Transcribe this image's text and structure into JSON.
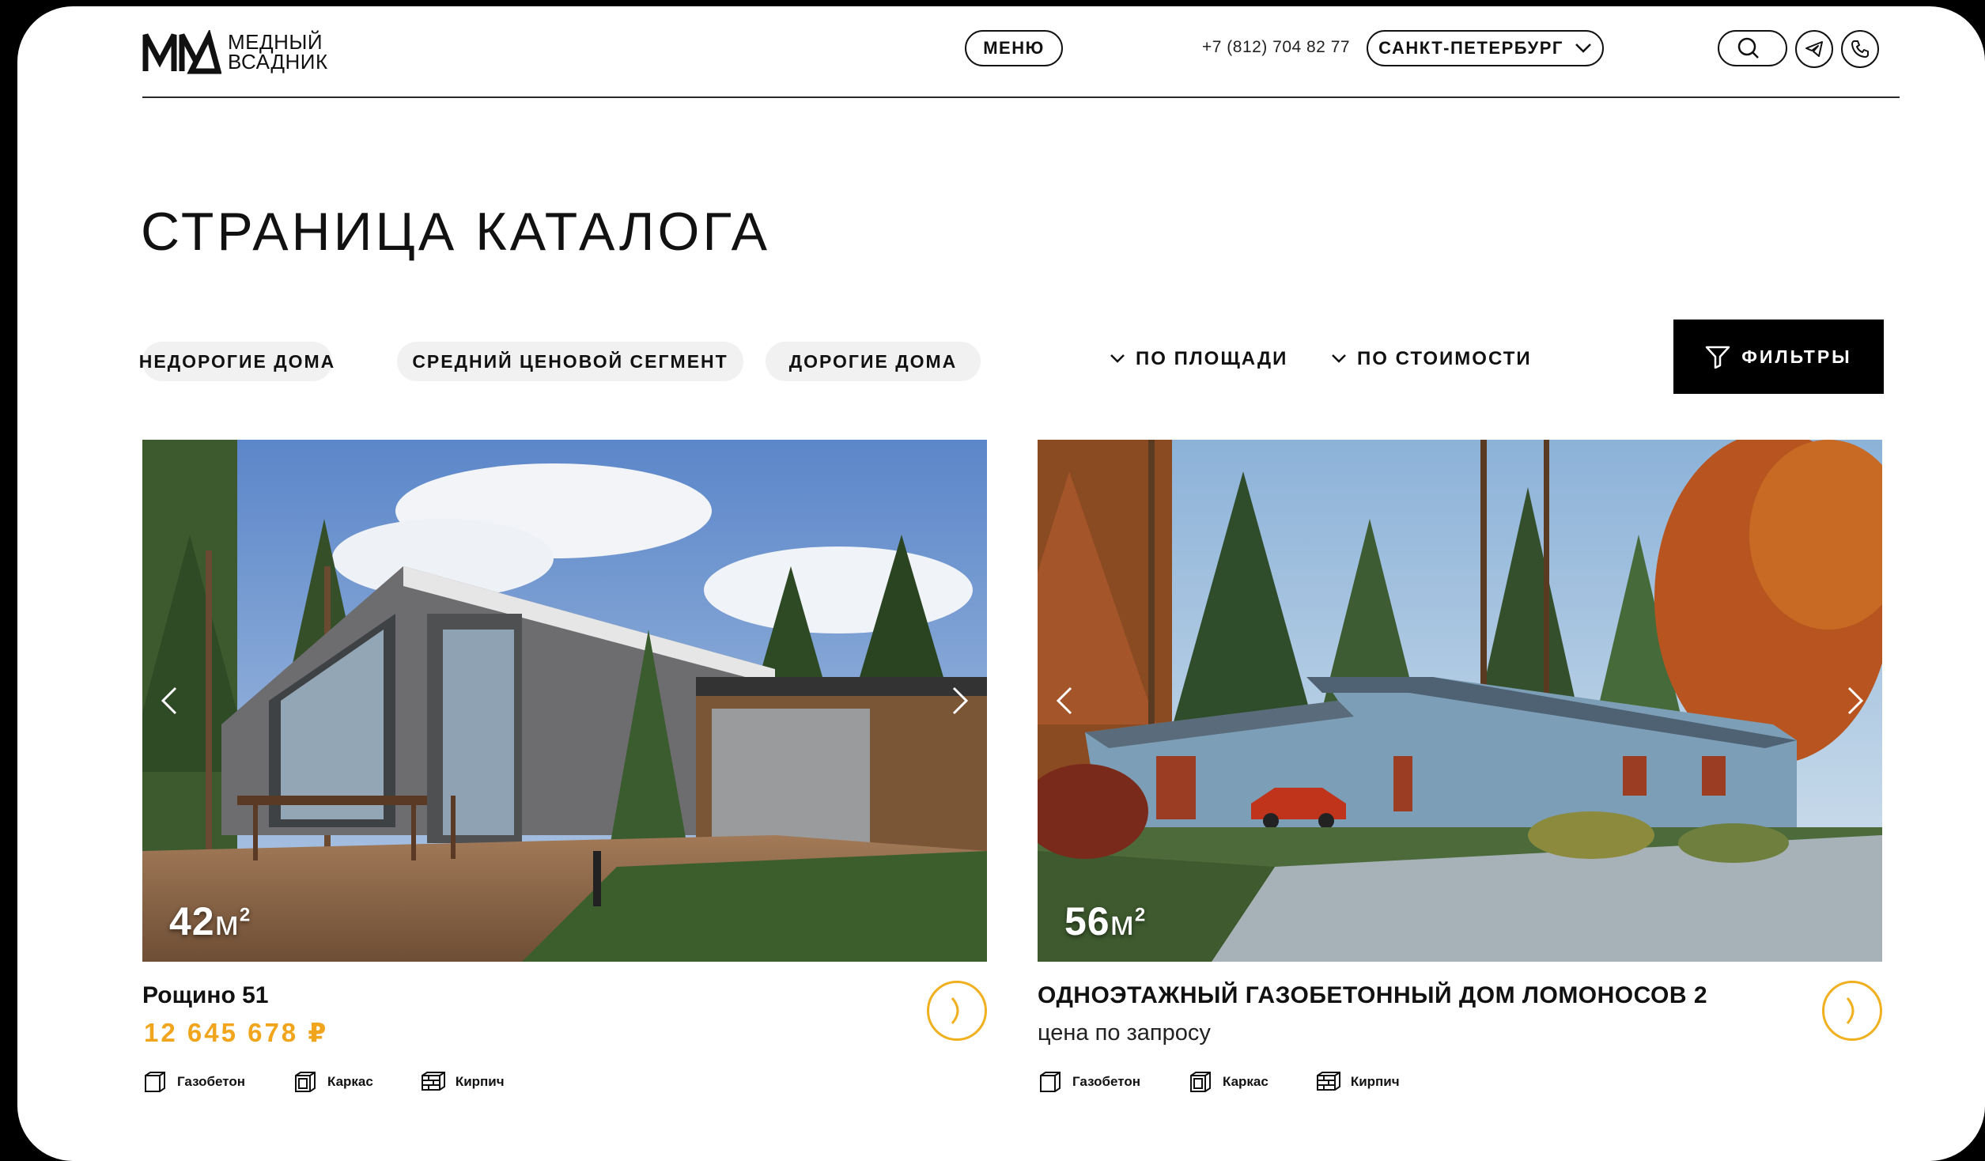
{
  "header": {
    "logo_line1": "МЕДНЫЙ",
    "logo_line2": "ВСАДНИК",
    "menu_label": "МЕНЮ",
    "phone": "+7 (812) 704 82 77",
    "city": "САНКТ-ПЕТЕРБУРГ"
  },
  "page": {
    "title": "СТРАНИЦА КАТАЛОГА"
  },
  "filters": {
    "chips": [
      "НЕДОРОГИЕ ДОМА",
      "СРЕДНИЙ ЦЕНОВОЙ СЕГМЕНТ",
      "ДОРОГИЕ ДОМА"
    ],
    "sort_area": "ПО ПЛОЩАДИ",
    "sort_price": "ПО СТОИМОСТИ",
    "filters_label": "ФИЛЬТРЫ"
  },
  "cards": [
    {
      "area_value": "42",
      "area_unit": "м",
      "area_exp": "2",
      "name": "Рощино 51",
      "price": "12 645 678 ₽",
      "materials": [
        "Газобетон",
        "Каркас",
        "Кирпич"
      ]
    },
    {
      "area_value": "56",
      "area_unit": "м",
      "area_exp": "2",
      "name": "ОДНОЭТАЖНЫЙ ГАЗОБЕТОННЫЙ ДОМ ЛОМОНОСОВ 2",
      "price_text": "цена по запросу",
      "materials": [
        "Газобетон",
        "Каркас",
        "Кирпич"
      ]
    }
  ],
  "colors": {
    "accent": "#f0a51c",
    "filter_button_bg": "#000000",
    "chip_bg": "#f1f1f1"
  },
  "icons": [
    "search-icon",
    "telegram-icon",
    "phone-icon",
    "chevron-down-icon",
    "filter-icon",
    "arrow-right-icon"
  ]
}
